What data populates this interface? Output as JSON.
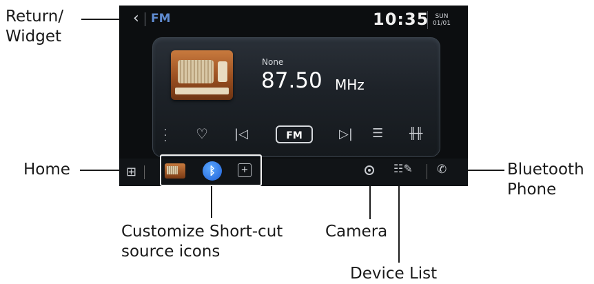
{
  "callouts": {
    "return_widget": "Return/\nWidget",
    "home": "Home",
    "shortcut": "Customize Short-cut\nsource icons",
    "camera": "Camera",
    "device_list": "Device List",
    "bt_phone": "Bluetooth\nPhone"
  },
  "screen": {
    "source": "FM",
    "time": "10:35",
    "day": "SUN",
    "date": "01/01",
    "station": "None",
    "frequency": "87.50",
    "unit": "MHz",
    "fm_button": "FM"
  },
  "icons": {
    "back": "chevron-left-icon",
    "more": "more-vertical-icon",
    "favorite": "heart-icon",
    "prev": "skip-previous-icon",
    "next": "skip-next-icon",
    "preset_list": "list-favorite-icon",
    "sound_settings": "equalizer-icon",
    "home": "apps-grid-icon",
    "shortcut_radio": "radio-icon",
    "shortcut_bluetooth": "bluetooth-icon",
    "shortcut_add": "add-icon",
    "camera": "camera-icon",
    "device_list": "device-list-icon",
    "phone": "phone-icon"
  },
  "colors": {
    "source_accent": "#5f8bd1",
    "bluetooth_blue": "#2a6fe0"
  }
}
